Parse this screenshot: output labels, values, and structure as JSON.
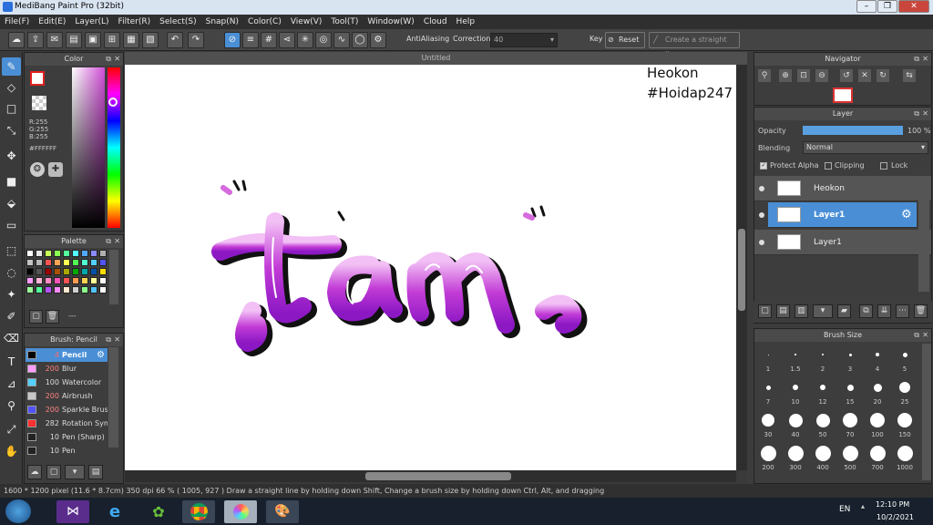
{
  "window": {
    "title": "MediBang Paint Pro (32bit)"
  },
  "menu": [
    "File(F)",
    "Edit(E)",
    "Layer(L)",
    "Filter(R)",
    "Select(S)",
    "Snap(N)",
    "Color(C)",
    "View(V)",
    "Tool(T)",
    "Window(W)",
    "Cloud",
    "Help"
  ],
  "toolbar": {
    "antialiasing_label": "AntiAliasing",
    "correction_label": "Correction",
    "correction_value": "40",
    "key_label": "Key",
    "reset_label": "Reset",
    "straight_line_label": "Create a straight line"
  },
  "color_panel": {
    "title": "Color",
    "r": "R:255",
    "g": "G:255",
    "b": "B:255",
    "hex": "#FFFFFF",
    "colors": {
      "hue_bar_top": "#ff0000",
      "picker_area": "#d14fd6"
    }
  },
  "palette_panel": {
    "title": "Palette",
    "name": "---",
    "colors": [
      "#ffffff",
      "#e8e8e8",
      "#c7ff57",
      "#8aff52",
      "#52ff9c",
      "#52ffff",
      "#52a8ff",
      "#8a8aff",
      "#b0b0b0",
      "#c3c3c3",
      "#b6b6b6",
      "#ff5252",
      "#ffa552",
      "#ffff52",
      "#52ff52",
      "#52ffcd",
      "#52d0ff",
      "#5252ff",
      "#000000",
      "#555555",
      "#9a0000",
      "#a85200",
      "#a8a800",
      "#00a800",
      "#00a8a8",
      "#0052a8",
      "#ffdd00",
      "#ff9aff",
      "#ffb6d8",
      "#ff8ac3",
      "#ff52b6",
      "#ff5252",
      "#ff9a52",
      "#ffd352",
      "#ffff99",
      "#ffffff",
      "#9aff9a",
      "#52ff9a",
      "#b652ff",
      "#ff8aff",
      "#ffe8cf",
      "#cfcfcf",
      "#8aff8a",
      "#52c3ff",
      "#ffffff"
    ]
  },
  "brush_panel": {
    "title": "Brush: Pencil",
    "items": [
      {
        "size": "4",
        "name": "Pencil",
        "color": "#000000",
        "selected": true
      },
      {
        "size": "200",
        "name": "Blur",
        "color": "#ff9aff"
      },
      {
        "size": "100",
        "name": "Watercolor",
        "color": "#52d0ff"
      },
      {
        "size": "200",
        "name": "Airbrush",
        "color": "#c8c8c8"
      },
      {
        "size": "200",
        "name": "Sparkle Brush",
        "color": "#5252ff"
      },
      {
        "size": "282",
        "name": "Rotation Sym",
        "color": "#ff3030"
      },
      {
        "size": "10",
        "name": "Pen (Sharp)",
        "color": "#222222"
      },
      {
        "size": "10",
        "name": "Pen",
        "color": "#222222"
      }
    ]
  },
  "canvas": {
    "tab": "Untitled",
    "text1": "Heokon",
    "text2": "#Hoidap247",
    "artwork": "tàn"
  },
  "navigator": {
    "title": "Navigator"
  },
  "layer_panel": {
    "title": "Layer",
    "opacity_label": "Opacity",
    "opacity_value": "100 %",
    "opacity_level": 1.0,
    "blending_label": "Blending",
    "blending_value": "Normal",
    "protect_alpha": "Protect Alpha",
    "clipping": "Clipping",
    "lock": "Lock",
    "layers": [
      {
        "name": "Heokon",
        "selected": false
      },
      {
        "name": "Layer1",
        "selected": true
      },
      {
        "name": "Layer1",
        "selected": false
      }
    ]
  },
  "brush_size_panel": {
    "title": "Brush Size",
    "sizes": [
      "1",
      "1.5",
      "2",
      "3",
      "4",
      "5",
      "7",
      "10",
      "12",
      "15",
      "20",
      "25",
      "30",
      "40",
      "50",
      "70",
      "100",
      "150",
      "200",
      "300",
      "400",
      "500",
      "700",
      "1000"
    ]
  },
  "status": {
    "dimensions": "1600 * 1200 pixel",
    "physical": "(11.6 * 8.7cm)",
    "dpi": "350 dpi",
    "zoom": "66 %",
    "coords": "( 1005, 927 )",
    "hint": "Draw a straight line by holding down Shift, Change a brush size by holding down Ctrl, Alt, and dragging"
  },
  "taskbar": {
    "language": "EN",
    "time": "12:10 PM",
    "date": "10/2/2021"
  }
}
